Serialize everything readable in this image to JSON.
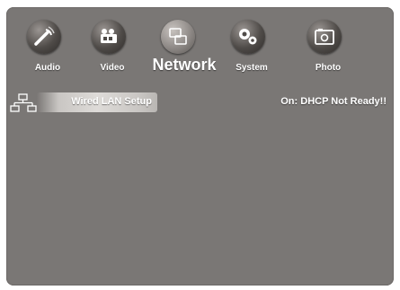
{
  "nav": {
    "items": [
      {
        "label": "Audio",
        "icon": "audio-icon",
        "active": false
      },
      {
        "label": "Video",
        "icon": "video-icon",
        "active": false
      },
      {
        "label": "Network",
        "icon": "network-icon",
        "active": true
      },
      {
        "label": "System",
        "icon": "system-icon",
        "active": false
      },
      {
        "label": "Photo",
        "icon": "photo-icon",
        "active": false
      }
    ]
  },
  "menu": {
    "selected_item": {
      "label": "Wired LAN Setup",
      "icon": "wired-lan-icon"
    },
    "status": "On: DHCP Not Ready!!"
  },
  "colors": {
    "background": "#7a7775",
    "text": "#ffffff",
    "highlight": "#dedbd8"
  }
}
